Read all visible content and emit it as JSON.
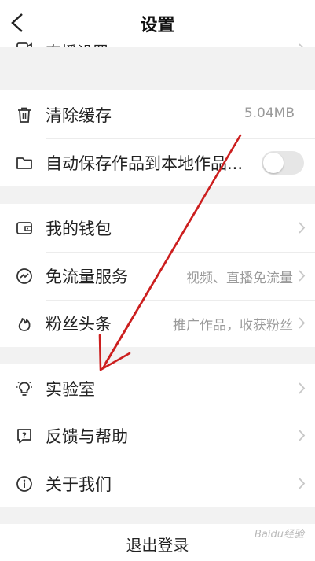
{
  "header": {
    "title": "设置"
  },
  "peek_item": {
    "label": "直播设置",
    "icon": "live-icon"
  },
  "storage": [
    {
      "label": "清除缓存",
      "value": "5.04MB",
      "icon": "trash-icon"
    },
    {
      "label": "自动保存作品到本地作品...",
      "toggle_on": false,
      "icon": "folder-icon"
    }
  ],
  "services": [
    {
      "label": "我的钱包",
      "value": "",
      "icon": "wallet-icon"
    },
    {
      "label": "免流量服务",
      "value": "视频、直播免流量",
      "icon": "data-free-icon"
    },
    {
      "label": "粉丝头条",
      "value": "推广作品，收获粉丝",
      "icon": "flame-icon"
    }
  ],
  "misc": [
    {
      "label": "实验室",
      "icon": "lightbulb-icon"
    },
    {
      "label": "反馈与帮助",
      "icon": "help-icon"
    },
    {
      "label": "关于我们",
      "icon": "info-icon"
    }
  ],
  "logout_label": "退出登录",
  "watermark": "Baidu经验",
  "colors": {
    "annotation_arrow": "#cc1f1f",
    "chevron": "#c8c8c8",
    "secondary_text": "#9a9a9a"
  }
}
